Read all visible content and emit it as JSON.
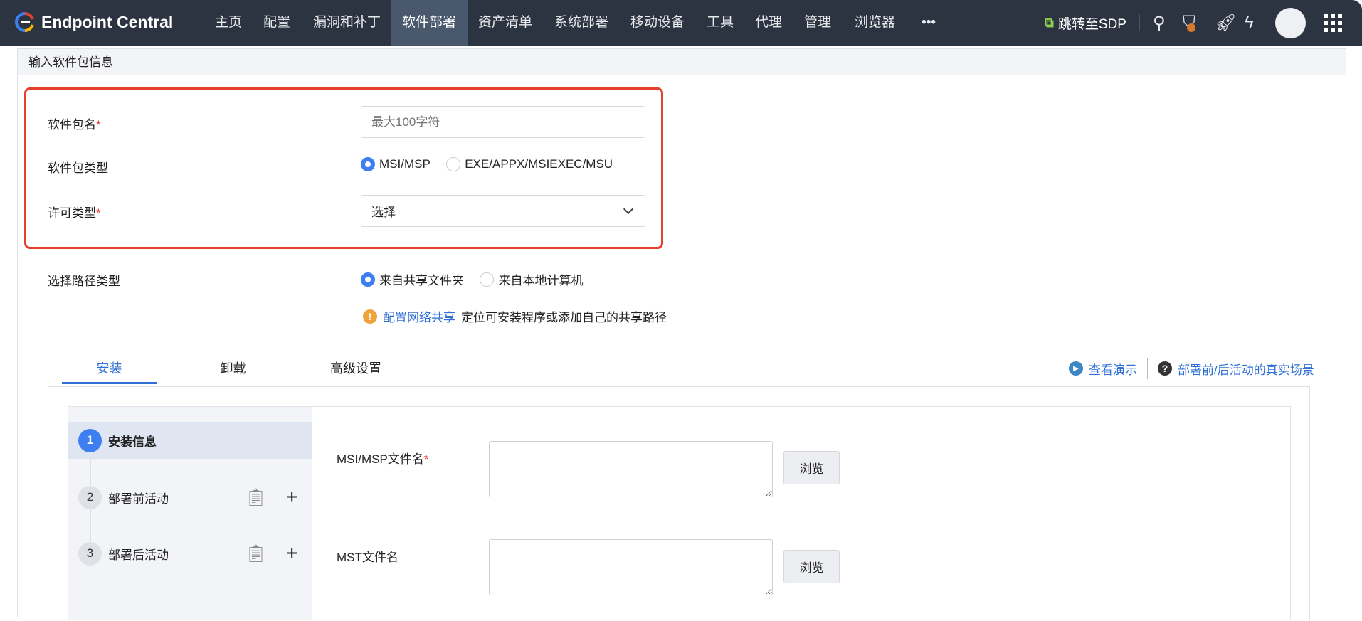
{
  "app": {
    "name": "Endpoint Central"
  },
  "nav": {
    "items": [
      "主页",
      "配置",
      "漏洞和补丁",
      "软件部署",
      "资产清单",
      "系统部署",
      "移动设备",
      "工具",
      "代理",
      "管理",
      "浏览器"
    ],
    "more": "•••",
    "sdp_link": "跳转至SDP"
  },
  "panel": {
    "title": "输入软件包信息"
  },
  "form": {
    "name_label": "软件包名",
    "name_placeholder": "最大100字符",
    "required": "*",
    "type_label": "软件包类型",
    "type_options": [
      "MSI/MSP",
      "EXE/APPX/MSIEXEC/MSU"
    ],
    "license_label": "许可类型",
    "license_value": "选择",
    "path_label": "选择路径类型",
    "path_options": [
      "来自共享文件夹",
      "来自本地计算机"
    ],
    "info_link": "配置网络共享",
    "info_text": "定位可安装程序或添加自己的共享路径"
  },
  "tabs": [
    "安装",
    "卸载",
    "高级设置"
  ],
  "help": {
    "demo": "查看演示",
    "scenarios": "部署前/后活动的真实场景"
  },
  "steps": [
    {
      "num": "1",
      "label": "安装信息"
    },
    {
      "num": "2",
      "label": "部署前活动"
    },
    {
      "num": "3",
      "label": "部署后活动"
    }
  ],
  "install": {
    "msi_label": "MSI/MSP文件名",
    "mst_label": "MST文件名",
    "browse": "浏览"
  },
  "colors": {
    "accent": "#3d7ef0",
    "nav_bg": "#2d3441",
    "highlight": "#e5402f"
  }
}
